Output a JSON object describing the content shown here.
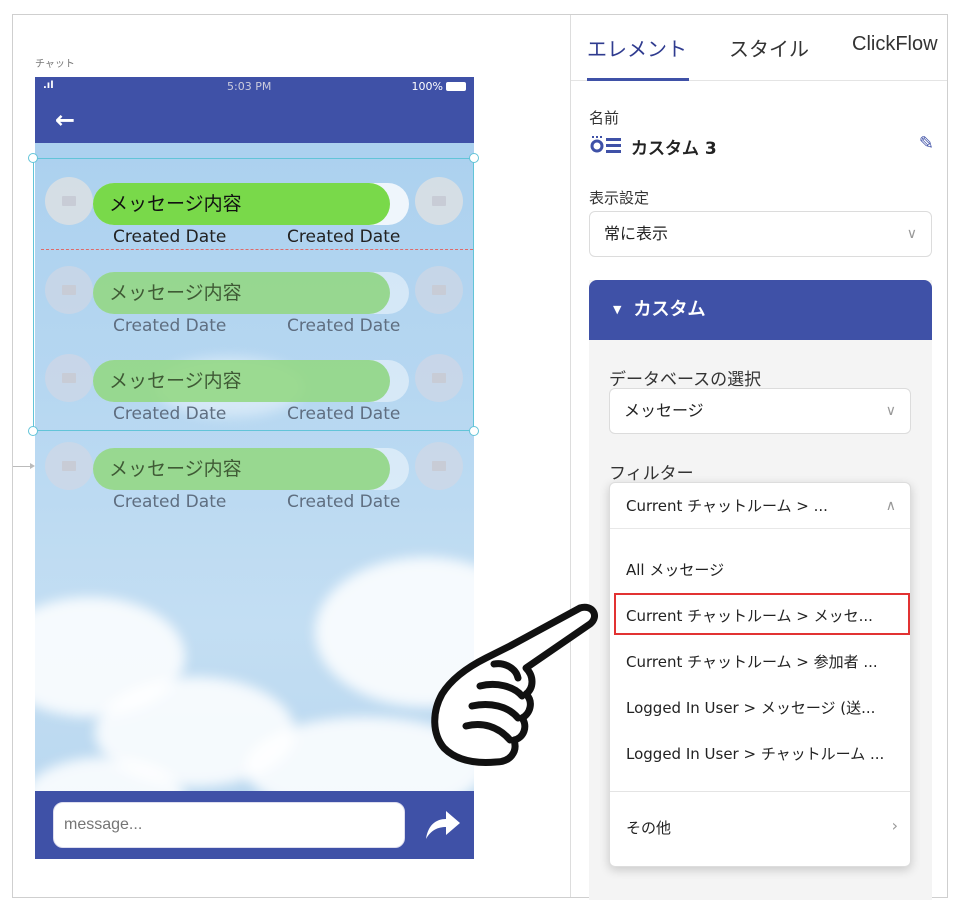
{
  "canvas": {
    "screen_label": "チャット",
    "status": {
      "time": "5:03 PM",
      "battery": "100%"
    },
    "messages": [
      {
        "text": "メッセージ内容",
        "date1": "Created Date",
        "date2": "Created Date"
      },
      {
        "text": "メッセージ内容",
        "date1": "Created Date",
        "date2": "Created Date"
      },
      {
        "text": "メッセージ内容",
        "date1": "Created Date",
        "date2": "Created Date"
      },
      {
        "text": "メッセージ内容",
        "date1": "Created Date",
        "date2": "Created Date"
      }
    ],
    "input_placeholder": "message..."
  },
  "panel": {
    "tabs": [
      {
        "label": "エレメント",
        "active": true
      },
      {
        "label": "スタイル",
        "active": false
      },
      {
        "label": "ClickFlow",
        "active": false
      }
    ],
    "name_label": "名前",
    "name_value": "カスタム 3",
    "display_label": "表示設定",
    "display_value": "常に表示",
    "section_title": "カスタム",
    "db_label": "データベースの選択",
    "db_value": "メッセージ",
    "filter_label": "フィルター",
    "filter_value": "Current チャットルーム > ...",
    "filter_options": [
      "All メッセージ",
      "Current チャットルーム > メッセ...",
      "Current チャットルーム > 参加者 ...",
      "Logged In User > メッセージ (送...",
      "Logged In User > チャットルーム ..."
    ],
    "filter_selected_index": 1,
    "filter_other": "その他"
  },
  "colors": {
    "brand": "#3f51a7",
    "bubble": "#79d94a",
    "highlight": "#e23232",
    "selection": "#62c4d8"
  }
}
